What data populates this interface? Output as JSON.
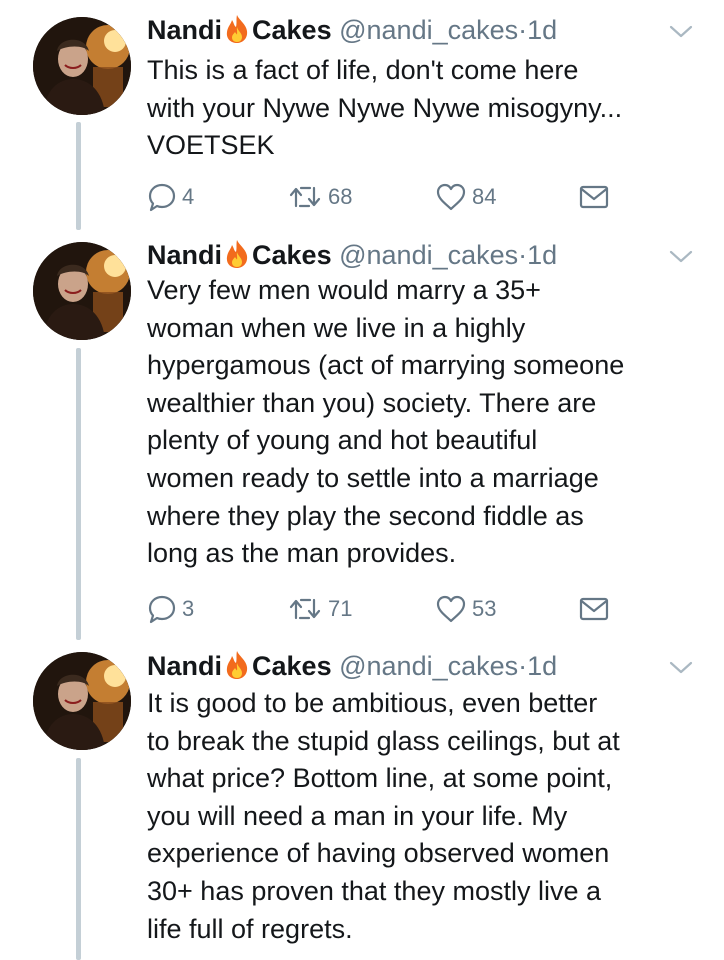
{
  "tweets": [
    {
      "name": "Nandi",
      "name_suffix": "Cakes",
      "handle": "@nandi_cakes",
      "separator": "·",
      "time": "1d",
      "text": "This is a fact of life, don't come here\nwith your Nywe Nywe Nywe misogyny...\nVOETSEK",
      "replies": "4",
      "retweets": "68",
      "likes": "84"
    },
    {
      "name": "Nandi",
      "name_suffix": "Cakes",
      "handle": "@nandi_cakes",
      "separator": "·",
      "time": "1d",
      "text": "Very few men would marry a 35+\nwoman when we live in a highly\nhypergamous (act of marrying someone\nwealthier than you) society. There are\nplenty of young and hot beautiful\nwomen ready to settle into a marriage\nwhere they play the second fiddle as\nlong as the man provides.",
      "replies": "3",
      "retweets": "71",
      "likes": "53"
    },
    {
      "name": "Nandi",
      "name_suffix": "Cakes",
      "handle": "@nandi_cakes",
      "separator": "·",
      "time": "1d",
      "text": "It is good to be ambitious, even better\nto break the stupid glass ceilings, but at\nwhat price? Bottom line, at some point,\nyou will need a man in your life. My\nexperience of having observed women\n30+ has proven that they mostly live a\nlife full of regrets.",
      "replies": "",
      "retweets": "",
      "likes": ""
    }
  ],
  "icons": {
    "name_emoji": "fire-icon",
    "menu": "chevron-down-icon",
    "reply": "reply-icon",
    "retweet": "retweet-icon",
    "like": "heart-icon",
    "message": "envelope-icon"
  },
  "colors": {
    "text": "#14171a",
    "secondary": "#657786",
    "thread_line": "#c4cfd6"
  }
}
